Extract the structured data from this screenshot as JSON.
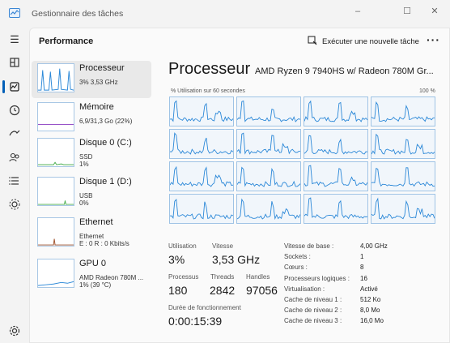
{
  "window": {
    "title": "Gestionnaire des tâches",
    "controls": [
      "–",
      "☐",
      "✕"
    ]
  },
  "header": {
    "title": "Performance",
    "run_task_label": "Exécuter une nouvelle tâche",
    "more_label": "···"
  },
  "devices": [
    {
      "name": "Processeur",
      "sub1": "3% 3,53 GHz",
      "sub2": "",
      "color": "#2b88d8"
    },
    {
      "name": "Mémoire",
      "sub1": "6,9/31,3 Go (22%)",
      "sub2": "",
      "color": "#8a3ac1"
    },
    {
      "name": "Disque 0 (C:)",
      "sub1": "SSD",
      "sub2": "1%",
      "color": "#4caf50"
    },
    {
      "name": "Disque 1 (D:)",
      "sub1": "USB",
      "sub2": "0%",
      "color": "#4caf50"
    },
    {
      "name": "Ethernet",
      "sub1": "Ethernet",
      "sub2": "E : 0 R : 0 Kbits/s",
      "color": "#a0522d"
    },
    {
      "name": "GPU 0",
      "sub1": "AMD Radeon 780M ...",
      "sub2": "1% (39 °C)",
      "color": "#2b88d8"
    }
  ],
  "main": {
    "title": "Processeur",
    "model": "AMD Ryzen 9 7940HS w/ Radeon 780M Gr...",
    "graph_left_label": "% Utilisation sur 60 secondes",
    "graph_right_label": "100 %",
    "stats": {
      "utilisation_label": "Utilisation",
      "utilisation_value": "3%",
      "vitesse_label": "Vitesse",
      "vitesse_value": "3,53 GHz",
      "processus_label": "Processus",
      "processus_value": "180",
      "threads_label": "Threads",
      "threads_value": "2842",
      "handles_label": "Handles",
      "handles_value": "97056",
      "uptime_label": "Durée de fonctionnement",
      "uptime_value": "0:00:15:39"
    },
    "specs": [
      {
        "k": "Vitesse de base :",
        "v": "4,00 GHz"
      },
      {
        "k": "Sockets :",
        "v": "1"
      },
      {
        "k": "Cœurs :",
        "v": "8"
      },
      {
        "k": "Processeurs logiques :",
        "v": "16"
      },
      {
        "k": "Virtualisation :",
        "v": "Activé"
      },
      {
        "k": "Cache de niveau 1 :",
        "v": "512 Ko"
      },
      {
        "k": "Cache de niveau 2 :",
        "v": "8,0 Mo"
      },
      {
        "k": "Cache de niveau 3 :",
        "v": "16,0 Mo"
      }
    ]
  },
  "rail_icons": [
    "hamburger-icon",
    "processes-icon",
    "performance-icon",
    "app-history-icon",
    "startup-icon",
    "users-icon",
    "details-icon",
    "services-icon",
    "settings-icon"
  ],
  "colors": {
    "accent": "#005fb8",
    "cpu_line": "#2b88d8",
    "grid_border": "#9fc3e5"
  }
}
